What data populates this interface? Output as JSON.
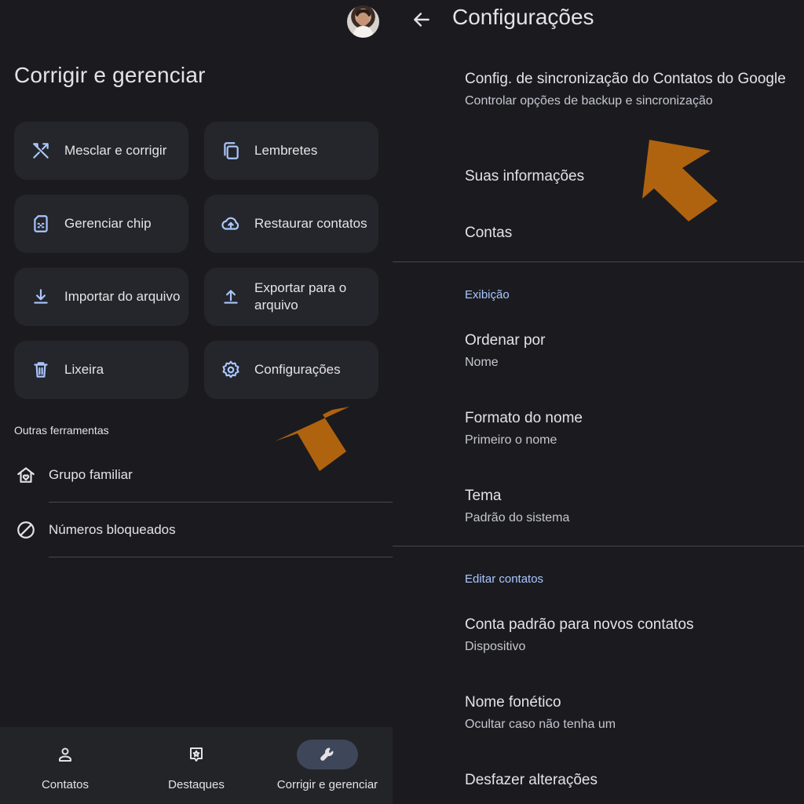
{
  "left": {
    "title": "Corrigir e gerenciar",
    "tiles": [
      {
        "label": "Mesclar e corrigir",
        "icon": "merge-fix-icon"
      },
      {
        "label": "Lembretes",
        "icon": "reminders-icon"
      },
      {
        "label": "Gerenciar chip",
        "icon": "sim-card-icon"
      },
      {
        "label": "Restaurar contatos",
        "icon": "cloud-restore-icon"
      },
      {
        "label": "Importar do arquivo",
        "icon": "download-icon"
      },
      {
        "label": "Exportar para o arquivo",
        "icon": "upload-icon"
      },
      {
        "label": "Lixeira",
        "icon": "trash-icon"
      },
      {
        "label": "Configurações",
        "icon": "gear-icon"
      }
    ],
    "other_tools_label": "Outras ferramentas",
    "tools": [
      {
        "label": "Grupo familiar",
        "icon": "family-home-icon"
      },
      {
        "label": "Números bloqueados",
        "icon": "block-icon"
      }
    ],
    "nav": [
      {
        "label": "Contatos",
        "icon": "person-icon",
        "active": false
      },
      {
        "label": "Destaques",
        "icon": "highlights-icon",
        "active": false
      },
      {
        "label": "Corrigir e gerenciar",
        "icon": "wrench-icon",
        "active": true
      }
    ]
  },
  "right": {
    "title": "Configurações",
    "settings_top": [
      {
        "title": "Config. de sincronização do Contatos do Google",
        "subtitle": "Controlar opções de backup e sincronização"
      },
      {
        "title": "Suas informações",
        "subtitle": ""
      },
      {
        "title": "Contas",
        "subtitle": ""
      }
    ],
    "display_category": "Exibição",
    "display_settings": [
      {
        "title": "Ordenar por",
        "subtitle": "Nome"
      },
      {
        "title": "Formato do nome",
        "subtitle": "Primeiro o nome"
      },
      {
        "title": "Tema",
        "subtitle": "Padrão do sistema"
      }
    ],
    "edit_category": "Editar contatos",
    "edit_settings": [
      {
        "title": "Conta padrão para novos contatos",
        "subtitle": "Dispositivo"
      },
      {
        "title": "Nome fonético",
        "subtitle": "Ocultar caso não tenha um"
      },
      {
        "title": "Desfazer alterações",
        "subtitle": ""
      }
    ]
  },
  "colors": {
    "background": "#1b1b1f",
    "tile": "#25262b",
    "accent": "#aac7ff",
    "annotation_arrow": "#b0630f"
  }
}
